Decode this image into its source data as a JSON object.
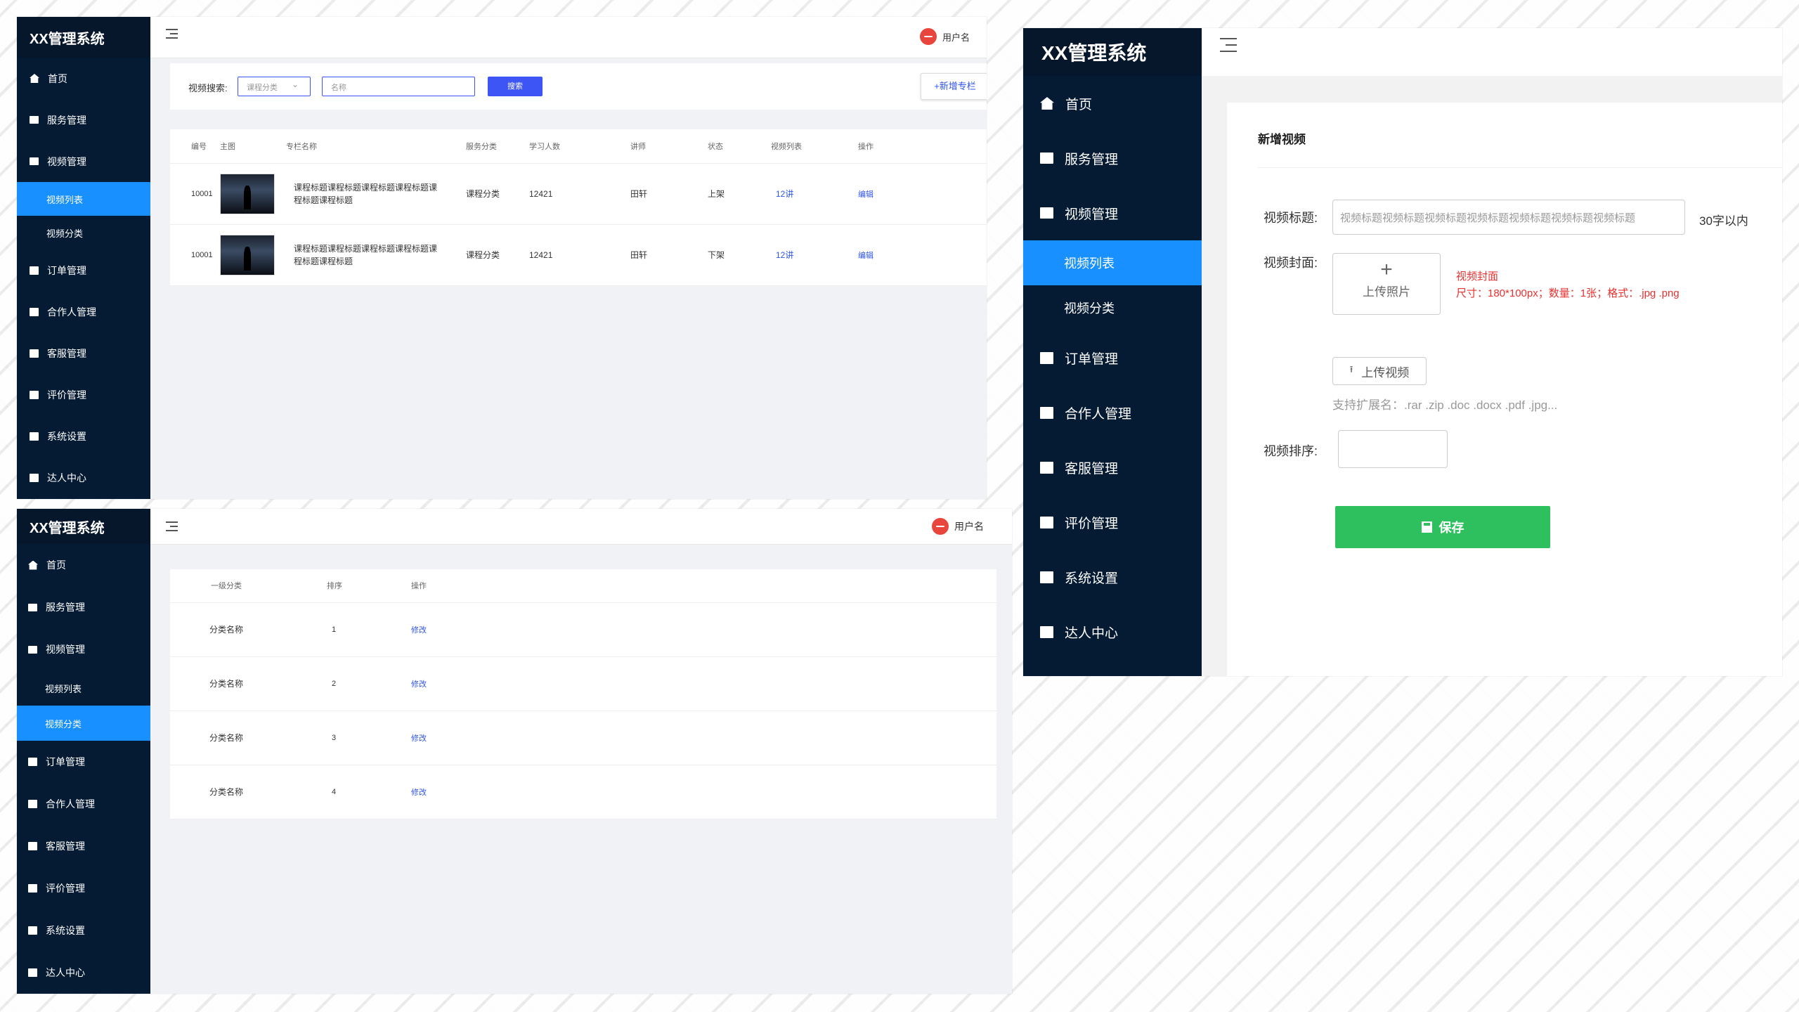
{
  "shared": {
    "app_title": "XX管理系统",
    "username": "用户名",
    "menu": {
      "home": "首页",
      "service": "服务管理",
      "video": "视频管理",
      "video_list": "视频列表",
      "video_category": "视频分类",
      "order": "订单管理",
      "partner": "合作人管理",
      "customer_service": "客服管理",
      "review": "评价管理",
      "settings": "系统设置",
      "expert": "达人中心"
    }
  },
  "list_page": {
    "search_label": "视频搜索:",
    "category_select": "课程分类",
    "name_placeholder": "名称",
    "search_button": "搜索",
    "add_button": "+新增专栏",
    "columns": [
      "编号",
      "主图",
      "专栏名称",
      "服务分类",
      "学习人数",
      "讲师",
      "状态",
      "视频列表",
      "操作"
    ],
    "rows": [
      {
        "id": "10001",
        "title": "课程标题课程标题课程标题课程标题课程标题课程标题",
        "category": "课程分类",
        "learners": "12421",
        "teacher": "田轩",
        "status": "上架",
        "videos": "12讲",
        "action": "编辑"
      },
      {
        "id": "10001",
        "title": "课程标题课程标题课程标题课程标题课程标题课程标题",
        "category": "课程分类",
        "learners": "12421",
        "teacher": "田轩",
        "status": "下架",
        "videos": "12讲",
        "action": "编辑"
      }
    ]
  },
  "category_page": {
    "columns": [
      "一级分类",
      "排序",
      "操作"
    ],
    "rows": [
      {
        "name": "分类名称",
        "order": "1",
        "action": "修改"
      },
      {
        "name": "分类名称",
        "order": "2",
        "action": "修改"
      },
      {
        "name": "分类名称",
        "order": "3",
        "action": "修改"
      },
      {
        "name": "分类名称",
        "order": "4",
        "action": "修改"
      }
    ]
  },
  "add_page": {
    "heading": "新增视频",
    "title_label": "视频标题:",
    "title_value": "视频标题视频标题视频标题视频标题视频标题视频标题视频标题",
    "title_limit": "30字以内",
    "cover_label": "视频封面:",
    "upload_photo": "上传照片",
    "cover_hint_title": "视频封面",
    "cover_hint_detail": "尺寸：180*100px；数量：1张；格式：.jpg .png",
    "upload_video": "上传视频",
    "ext_hint": "支持扩展名：.rar .zip .doc .docx .pdf .jpg...",
    "sort_label": "视频排序:",
    "save_button": "保存"
  },
  "colors": {
    "sidebar": "#051b33",
    "active": "#1890ff",
    "primary": "#3d55f5",
    "save": "#2ec05e",
    "hint_red": "#e8312f"
  }
}
